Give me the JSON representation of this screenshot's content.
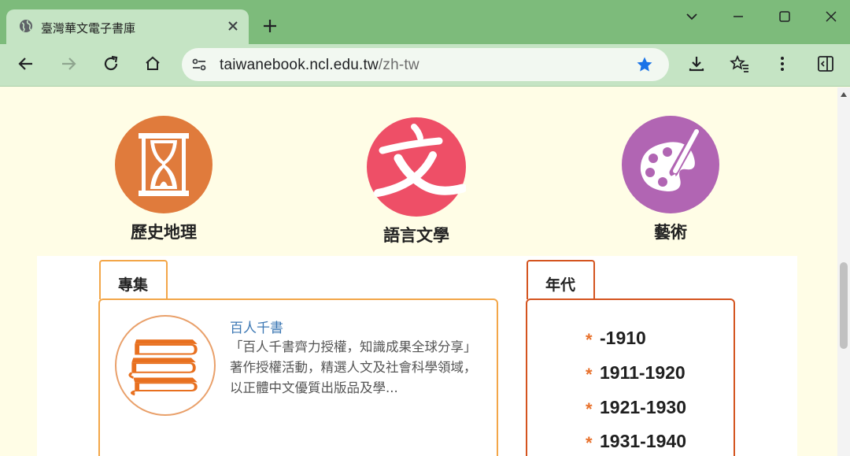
{
  "browser": {
    "tab_title": "臺灣華文電子書庫",
    "url_host": "taiwanebook.ncl.edu.tw",
    "url_path": "/zh-tw"
  },
  "categories": [
    {
      "label": "歷史地理",
      "icon": "hourglass-icon",
      "color": "#e07b3c"
    },
    {
      "label": "語言文學",
      "icon": "wen-character-icon",
      "color": "#ee4f67"
    },
    {
      "label": "藝術",
      "icon": "palette-icon",
      "color": "#b165b3"
    }
  ],
  "collection": {
    "tab_label": "專集",
    "border_color": "#f3a648",
    "item_title": "百人千書",
    "item_description": "「百人千書齊力授權，知識成果全球分享」著作授權活動，精選人文及社會科學領域，以正體中文優質出版品及學..."
  },
  "era": {
    "tab_label": "年代",
    "border_color": "#d4541f",
    "decades": [
      "-1910",
      "1911-1920",
      "1921-1930",
      "1931-1940"
    ]
  }
}
